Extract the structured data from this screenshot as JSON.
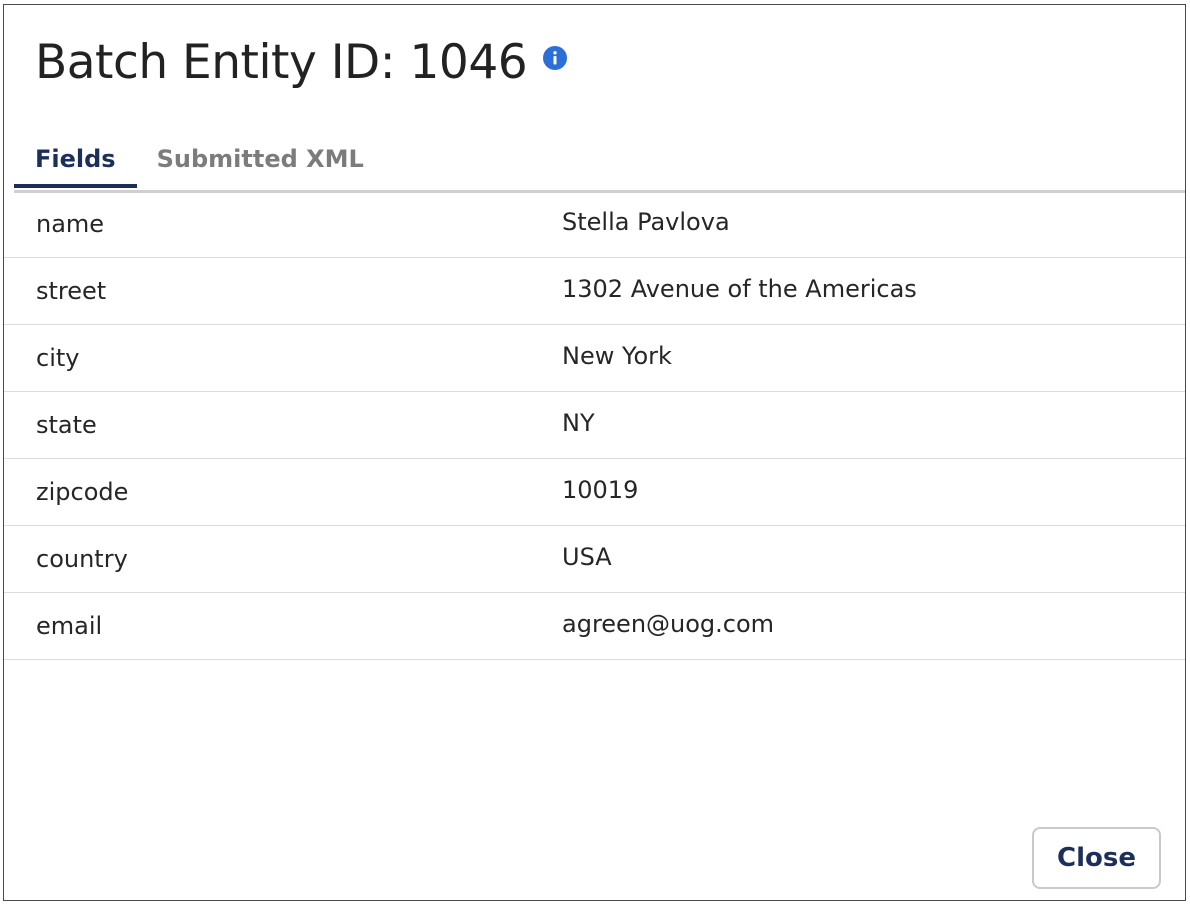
{
  "dialog": {
    "title": "Batch Entity ID: 1046",
    "info_icon": "info-icon",
    "info_icon_color": "#2c6fd6"
  },
  "tabs": [
    {
      "label": "Fields",
      "active": true
    },
    {
      "label": "Submitted XML",
      "active": false
    }
  ],
  "fields": [
    {
      "key": "name",
      "value": "Stella Pavlova"
    },
    {
      "key": "street",
      "value": "1302 Avenue of the Americas"
    },
    {
      "key": "city",
      "value": "New York"
    },
    {
      "key": "state",
      "value": "NY"
    },
    {
      "key": "zipcode",
      "value": "10019"
    },
    {
      "key": "country",
      "value": "USA"
    },
    {
      "key": "email",
      "value": "agreen@uog.com"
    }
  ],
  "footer": {
    "close_label": "Close"
  },
  "colors": {
    "accent": "#1c2f5a",
    "tab_inactive": "#7c7c7c",
    "divider": "#dcdcdc"
  }
}
